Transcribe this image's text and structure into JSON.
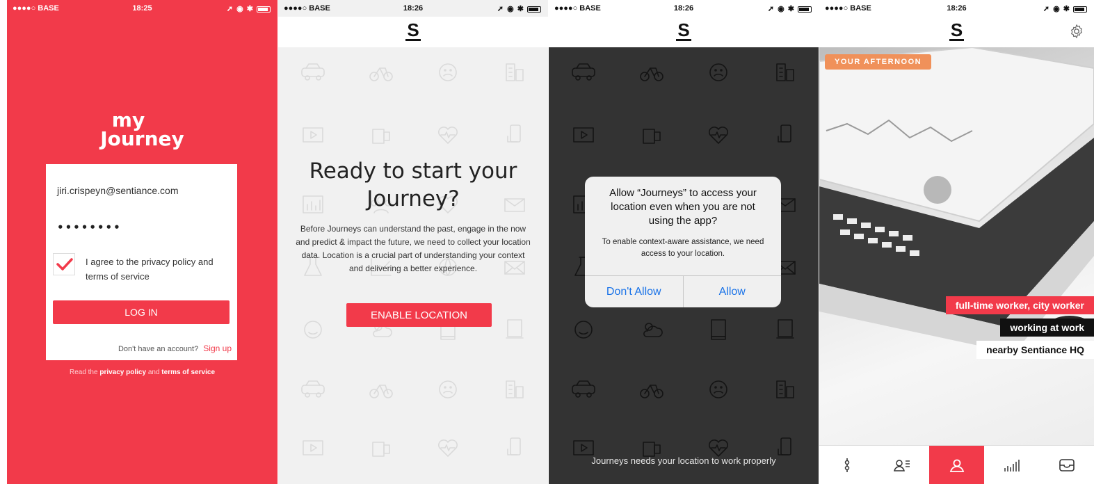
{
  "screen1": {
    "status": {
      "carrier": "●●●●○ BASE",
      "time": "18:25"
    },
    "logo": {
      "line1": "my",
      "line2": "Journey"
    },
    "email_value": "jiri.crispeyn@sentiance.com",
    "password_mask": "••••••••",
    "agree_text": "I agree to the privacy policy and terms of service",
    "login_label": "LOG IN",
    "no_account_text": "Don't have an account?",
    "signup_label": "Sign up",
    "policy_prefix": "Read the",
    "policy_link1": "privacy policy",
    "policy_and": "and",
    "policy_link2": "terms of service"
  },
  "screen2": {
    "status": {
      "carrier": "●●●●○ BASE",
      "time": "18:26"
    },
    "brand": "S",
    "title": "Ready to start your Journey?",
    "body": "Before Journeys can understand the past, engage in the now and predict & impact the future, we need to collect your location data. Location is a crucial part of understanding your context and delivering a better experience.",
    "enable_label": "ENABLE LOCATION"
  },
  "screen3": {
    "status": {
      "carrier": "●●●●○ BASE",
      "time": "18:26"
    },
    "brand": "S",
    "alert_title": "Allow “Journeys” to access your location even when you are not using the app?",
    "alert_message": "To enable context-aware assistance, we need access to your location.",
    "deny_label": "Don't Allow",
    "allow_label": "Allow",
    "footer_text": "Journeys needs your location to work properly"
  },
  "screen4": {
    "status": {
      "carrier": "●●●●○ BASE",
      "time": "18:26"
    },
    "brand": "S",
    "period_badge": "YOUR AFTERNOON",
    "tags": [
      "full-time worker, city worker",
      "working at work",
      "nearby Sentiance HQ"
    ],
    "tabs": [
      "timeline-icon",
      "profile-list-icon",
      "home-user-icon",
      "stats-icon",
      "inbox-icon"
    ],
    "active_tab": 2
  },
  "colors": {
    "accent": "#f23a4a",
    "badge": "#f0915a",
    "dark": "#333333",
    "ios_blue": "#1a73e8"
  }
}
